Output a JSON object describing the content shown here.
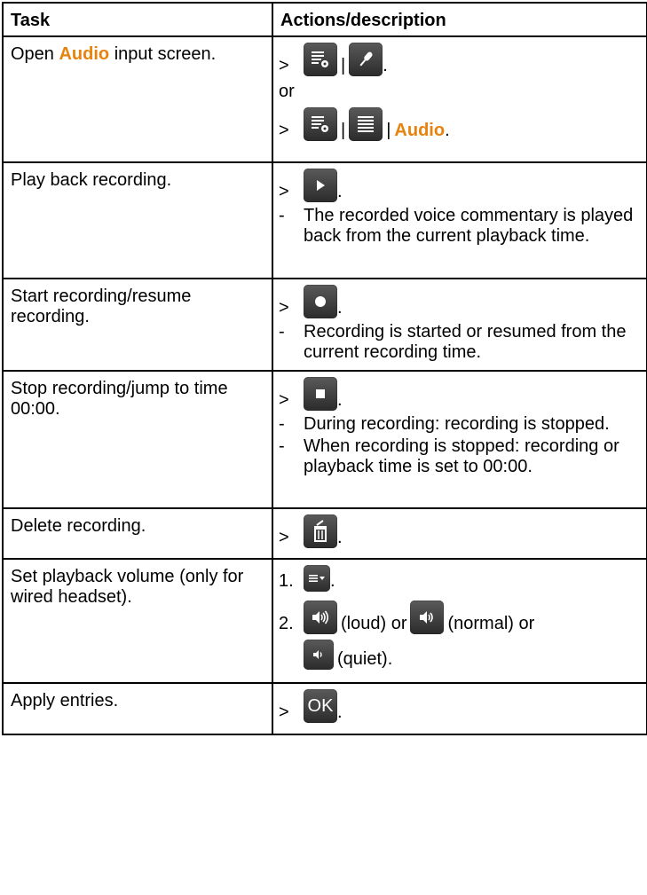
{
  "headers": {
    "task": "Task",
    "actions": "Actions/description"
  },
  "rows": [
    {
      "task": "Open Audio input screen.",
      "task_pre": "Open ",
      "task_hl": "Audio",
      "task_post": " input screen.",
      "or": "or",
      "audio": "Audio",
      "marker": ">",
      "pipe": "|",
      "dot": "."
    },
    {
      "task": "Play back recording.",
      "marker": ">",
      "dot": ".",
      "result": "The recorded voice commentary is played back from the current playback time."
    },
    {
      "task": "Start recording/resume recording.",
      "marker": ">",
      "dot": ".",
      "result": "Recording is started or resumed from the current recording time."
    },
    {
      "task": "Stop recording/jump to time 00:00.",
      "marker": ">",
      "dot": ".",
      "result1": "During recording: recording is stopped.",
      "result2": "When recording is stopped: recording or playback time is set to 00:00."
    },
    {
      "task": "Delete recording.",
      "marker": ">",
      "dot": "."
    },
    {
      "task": "Set playback volume (only for wired headset).",
      "step1": "1.",
      "step2": "2.",
      "dot": ".",
      "loud": "(loud) or",
      "normal": "(normal) or",
      "quiet": "(quiet)."
    },
    {
      "task": "Apply entries.",
      "marker": ">",
      "dot": ".",
      "ok": "OK"
    }
  ],
  "dash": "-",
  "colors": {
    "highlight": "#E8820C",
    "button": "#3a3a3a"
  },
  "icons": [
    "menu-settings-icon",
    "microphone-icon",
    "list-icon",
    "play-icon",
    "record-icon",
    "stop-icon",
    "delete-icon",
    "dropdown-menu-icon",
    "volume-loud-icon",
    "volume-normal-icon",
    "volume-quiet-icon"
  ]
}
